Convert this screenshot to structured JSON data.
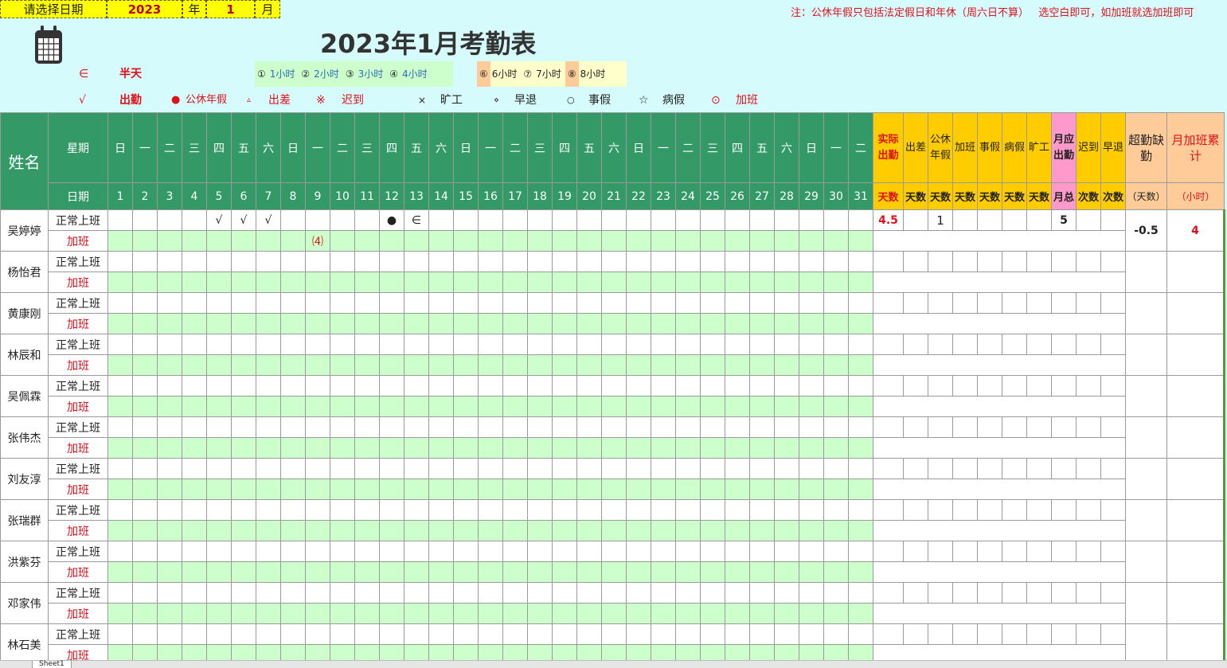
{
  "selector": {
    "prompt": "请选择日期",
    "year": "2023",
    "year_unit": "年",
    "month": "1",
    "month_unit": "月"
  },
  "title": "2023年1月考勤表",
  "note": "注：公休年假只包括法定假日和年休（周六日不算）   选空白即可，如加班就选加班即可",
  "legend": {
    "half_sym": "∈",
    "half": "半天",
    "att_sym": "√",
    "att": "出勤",
    "leave_sym": "●",
    "leave": "公休年假",
    "trip_sym": "▵",
    "trip": "出差",
    "late_sym": "※",
    "late": "迟到",
    "absent_sym": "×",
    "absent": "旷工",
    "early_sym": "⋄",
    "early": "早退",
    "personal_sym": "○",
    "personal": "事假",
    "sick_sym": "☆",
    "sick": "病假",
    "ot_sym": "⊙",
    "ot": "加班",
    "hours1": [
      [
        "①",
        "1小时"
      ],
      [
        "②",
        "2小时"
      ],
      [
        "③",
        "3小时"
      ],
      [
        "④",
        "4小时"
      ]
    ],
    "hours2": [
      [
        "⑥",
        "6小时"
      ],
      [
        "⑦",
        "7小时"
      ],
      [
        "⑧",
        "8小时"
      ]
    ]
  },
  "header": {
    "name": "姓名",
    "weekday": "星期",
    "date": "日期",
    "weekdays": [
      "日",
      "一",
      "二",
      "三",
      "四",
      "五",
      "六",
      "日",
      "一",
      "二",
      "三",
      "四",
      "五",
      "六",
      "日",
      "一",
      "二",
      "三",
      "四",
      "五",
      "六",
      "日",
      "一",
      "二",
      "三",
      "四",
      "五",
      "六",
      "日",
      "一",
      "二"
    ],
    "days": [
      "1",
      "2",
      "3",
      "4",
      "5",
      "6",
      "7",
      "8",
      "9",
      "10",
      "11",
      "12",
      "13",
      "14",
      "15",
      "16",
      "17",
      "18",
      "19",
      "20",
      "21",
      "22",
      "23",
      "24",
      "25",
      "26",
      "27",
      "28",
      "29",
      "30",
      "31"
    ],
    "stats": [
      {
        "top": "实际出勤",
        "bottom": "天数",
        "cls": "yl r b"
      },
      {
        "top": "出差",
        "bottom": "天数",
        "cls": "yl"
      },
      {
        "top": "公休年假",
        "bottom": "天数",
        "cls": "yl"
      },
      {
        "top": "加班",
        "bottom": "天数",
        "cls": "yl"
      },
      {
        "top": "事假",
        "bottom": "天数",
        "cls": "yl"
      },
      {
        "top": "病假",
        "bottom": "天数",
        "cls": "yl"
      },
      {
        "top": "旷工",
        "bottom": "天数",
        "cls": "yl"
      },
      {
        "top": "月应出勤",
        "bottom": "月总",
        "cls": "pk b"
      },
      {
        "top": "迟到",
        "bottom": "次数",
        "cls": "yl"
      },
      {
        "top": "早退",
        "bottom": "次数",
        "cls": "yl"
      }
    ],
    "extra": [
      {
        "top": "超勤缺勤",
        "bottom": "（天数）"
      },
      {
        "top": "月加班累计",
        "bottom": "（小时）"
      }
    ],
    "normal": "正常上班",
    "overtime": "加班"
  },
  "employees": [
    {
      "name": "吴婷婷",
      "normal": {
        "5": "√",
        "6": "√",
        "7": "√",
        "12": "●",
        "13": "∈"
      },
      "overtime": {
        "9": "⑷"
      },
      "stats": [
        "4.5",
        "",
        "1",
        "",
        "",
        "",
        "",
        "5",
        "",
        ""
      ],
      "extra": [
        "-0.5",
        "4"
      ]
    },
    {
      "name": "杨怡君",
      "normal": {},
      "overtime": {},
      "stats": [
        "",
        "",
        "",
        "",
        "",
        "",
        "",
        "",
        "",
        ""
      ],
      "extra": [
        "",
        ""
      ]
    },
    {
      "name": "黄康刚",
      "normal": {},
      "overtime": {},
      "stats": [
        "",
        "",
        "",
        "",
        "",
        "",
        "",
        "",
        "",
        ""
      ],
      "extra": [
        "",
        ""
      ]
    },
    {
      "name": "林辰和",
      "normal": {},
      "overtime": {},
      "stats": [
        "",
        "",
        "",
        "",
        "",
        "",
        "",
        "",
        "",
        ""
      ],
      "extra": [
        "",
        ""
      ]
    },
    {
      "name": "吴佩霖",
      "normal": {},
      "overtime": {},
      "stats": [
        "",
        "",
        "",
        "",
        "",
        "",
        "",
        "",
        "",
        ""
      ],
      "extra": [
        "",
        ""
      ]
    },
    {
      "name": "张伟杰",
      "normal": {},
      "overtime": {},
      "stats": [
        "",
        "",
        "",
        "",
        "",
        "",
        "",
        "",
        "",
        ""
      ],
      "extra": [
        "",
        ""
      ]
    },
    {
      "name": "刘友淳",
      "normal": {},
      "overtime": {},
      "stats": [
        "",
        "",
        "",
        "",
        "",
        "",
        "",
        "",
        "",
        ""
      ],
      "extra": [
        "",
        ""
      ]
    },
    {
      "name": "张瑞群",
      "normal": {},
      "overtime": {},
      "stats": [
        "",
        "",
        "",
        "",
        "",
        "",
        "",
        "",
        "",
        ""
      ],
      "extra": [
        "",
        ""
      ]
    },
    {
      "name": "洪紫芬",
      "normal": {},
      "overtime": {},
      "stats": [
        "",
        "",
        "",
        "",
        "",
        "",
        "",
        "",
        "",
        ""
      ],
      "extra": [
        "",
        ""
      ]
    },
    {
      "name": "邓家伟",
      "normal": {},
      "overtime": {},
      "stats": [
        "",
        "",
        "",
        "",
        "",
        "",
        "",
        "",
        "",
        ""
      ],
      "extra": [
        "",
        ""
      ]
    },
    {
      "name": "林石美",
      "normal": {},
      "overtime": {},
      "stats": [
        "",
        "",
        "",
        "",
        "",
        "",
        "",
        "",
        "",
        ""
      ],
      "extra": [
        "",
        ""
      ]
    }
  ],
  "sheet_tab": "Sheet1"
}
